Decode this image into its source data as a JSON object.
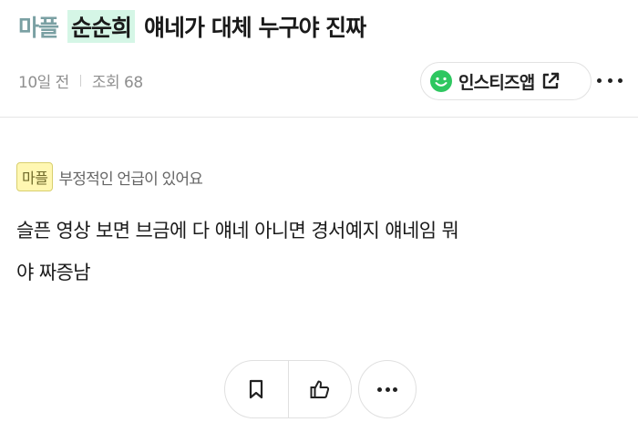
{
  "title": {
    "prefix": "마플",
    "highlight": "순순희",
    "rest": "얘네가 대체 누구야 진짜"
  },
  "meta": {
    "time": "10일 전",
    "views": "조회 68"
  },
  "app_button": {
    "label": "인스티즈앱"
  },
  "notice": {
    "tag": "마플",
    "text": "부정적인 언급이 있어요"
  },
  "body": {
    "line1": "슬픈 영상 보면 브금에 다 얘네 아니면 경서예지 얘네임 뭐",
    "line2": "야 짜증남"
  },
  "icons": {
    "app_logo": "smiley-icon",
    "external_link": "external-link-icon",
    "more": "more-icon",
    "bookmark": "bookmark-icon",
    "like": "thumbs-up-icon"
  },
  "colors": {
    "highlight": "#d5f6e6",
    "prefix": "#7aa0a3",
    "logo_green": "#2ec760",
    "notice_tag_bg": "#fff7b2"
  }
}
